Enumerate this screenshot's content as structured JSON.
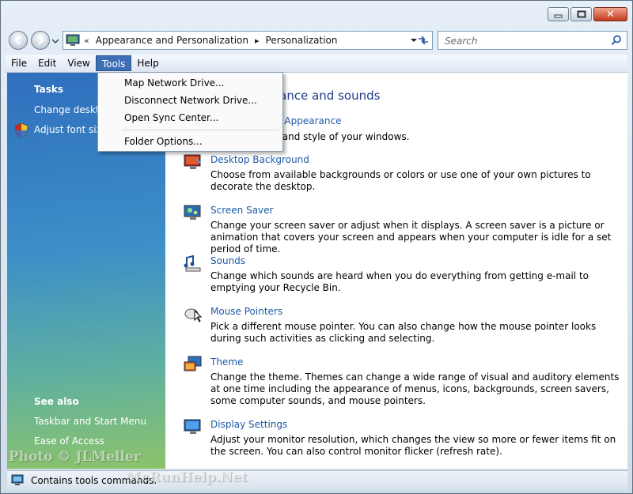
{
  "window": {
    "close_glyph": "✕"
  },
  "address": {
    "overflow": "«",
    "crumbs": [
      "Appearance and Personalization",
      "Personalization"
    ],
    "separator": "▸"
  },
  "search": {
    "placeholder": "Search"
  },
  "menubar": {
    "items": [
      "File",
      "Edit",
      "View",
      "Tools",
      "Help"
    ],
    "active": "Tools"
  },
  "tools_menu": {
    "items": [
      "Map Network Drive...",
      "Disconnect Network Drive...",
      "Open Sync Center...",
      "Folder Options..."
    ]
  },
  "sidebar": {
    "tasks_heading": "Tasks",
    "tasks": [
      "Change deskto",
      "Adjust font size"
    ],
    "see_also_heading": "See also",
    "see_also": [
      "Taskbar and Start Menu",
      "Ease of Access"
    ]
  },
  "content": {
    "heading": "rance and sounds",
    "first_link": "d Appearance",
    "first_desc": "r and style of your windows.",
    "items": [
      {
        "title": "Desktop Background",
        "icon": "desktop-background-icon",
        "desc": "Choose from available backgrounds or colors or use one of your own pictures to decorate the desktop."
      },
      {
        "title": "Screen Saver",
        "icon": "screen-saver-icon",
        "desc": "Change your screen saver or adjust when it displays. A screen saver is a picture or animation that covers your screen and appears when your computer is idle for a set period of time."
      },
      {
        "title": "Sounds",
        "icon": "sounds-icon",
        "desc": "Change which sounds are heard when you do everything from getting e-mail to emptying your Recycle Bin."
      },
      {
        "title": "Mouse Pointers",
        "icon": "mouse-icon",
        "desc": "Pick a different mouse pointer. You can also change how the mouse pointer looks during such activities as clicking and selecting."
      },
      {
        "title": "Theme",
        "icon": "theme-icon",
        "desc": "Change the theme. Themes can change a wide range of visual and auditory elements at one time including the appearance of menus, icons, backgrounds, screen savers, some computer sounds, and mouse pointers."
      },
      {
        "title": "Display Settings",
        "icon": "display-settings-icon",
        "desc": "Adjust your monitor resolution, which changes the view so more or fewer items fit on the screen. You can also control monitor flicker (refresh rate)."
      }
    ]
  },
  "status": {
    "text": "Contains tools commands."
  },
  "watermark": {
    "photo": "Photo © JLMeller",
    "site": "MeRunHelp.Net"
  },
  "colors": {
    "link": "#1e5aa8",
    "heading": "#1e3a8c",
    "menu_active": "#3d6fb6"
  }
}
